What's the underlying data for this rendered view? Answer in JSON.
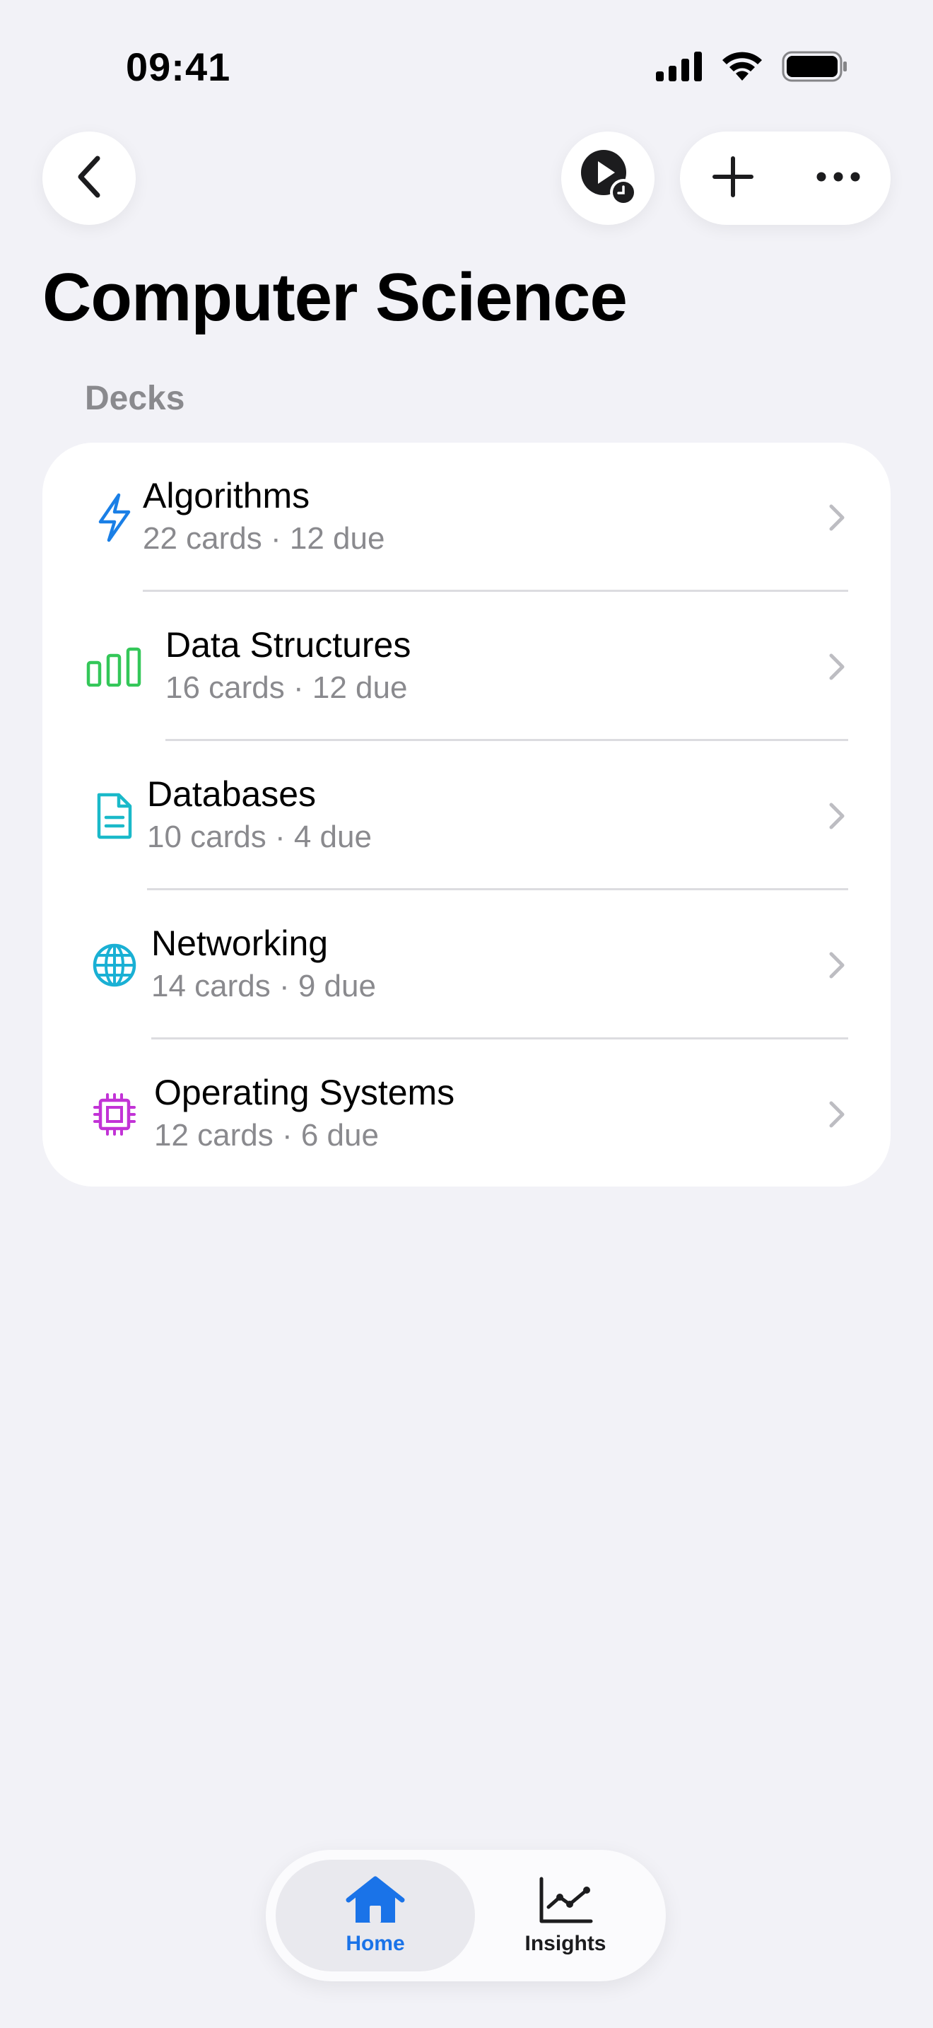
{
  "status_bar": {
    "time": "09:41",
    "icons": [
      "cellular-signal-icon",
      "wifi-icon",
      "battery-icon"
    ]
  },
  "nav": {
    "back_icon": "chevron-left-icon",
    "play_icon": "play-schedule-icon",
    "add_icon": "plus-icon",
    "more_icon": "ellipsis-icon"
  },
  "page": {
    "title": "Computer Science",
    "section_header": "Decks"
  },
  "decks": [
    {
      "name": "Algorithms",
      "meta": "22 cards · 12 due",
      "icon": "lightning-icon",
      "color": "#1a7fe6"
    },
    {
      "name": "Data Structures",
      "meta": "16 cards · 12 due",
      "icon": "bar-chart-icon",
      "color": "#34c759"
    },
    {
      "name": "Databases",
      "meta": "10 cards · 4 due",
      "icon": "document-icon",
      "color": "#1ab9c9"
    },
    {
      "name": "Networking",
      "meta": "14 cards · 9 due",
      "icon": "globe-icon",
      "color": "#1ab0d4"
    },
    {
      "name": "Operating Systems",
      "meta": "12 cards · 6 due",
      "icon": "cpu-chip-icon",
      "color": "#c233d6"
    }
  ],
  "tab_bar": {
    "home": {
      "label": "Home",
      "icon": "house-icon",
      "color": "#1a73e8"
    },
    "insights": {
      "label": "Insights",
      "icon": "line-chart-icon"
    }
  }
}
